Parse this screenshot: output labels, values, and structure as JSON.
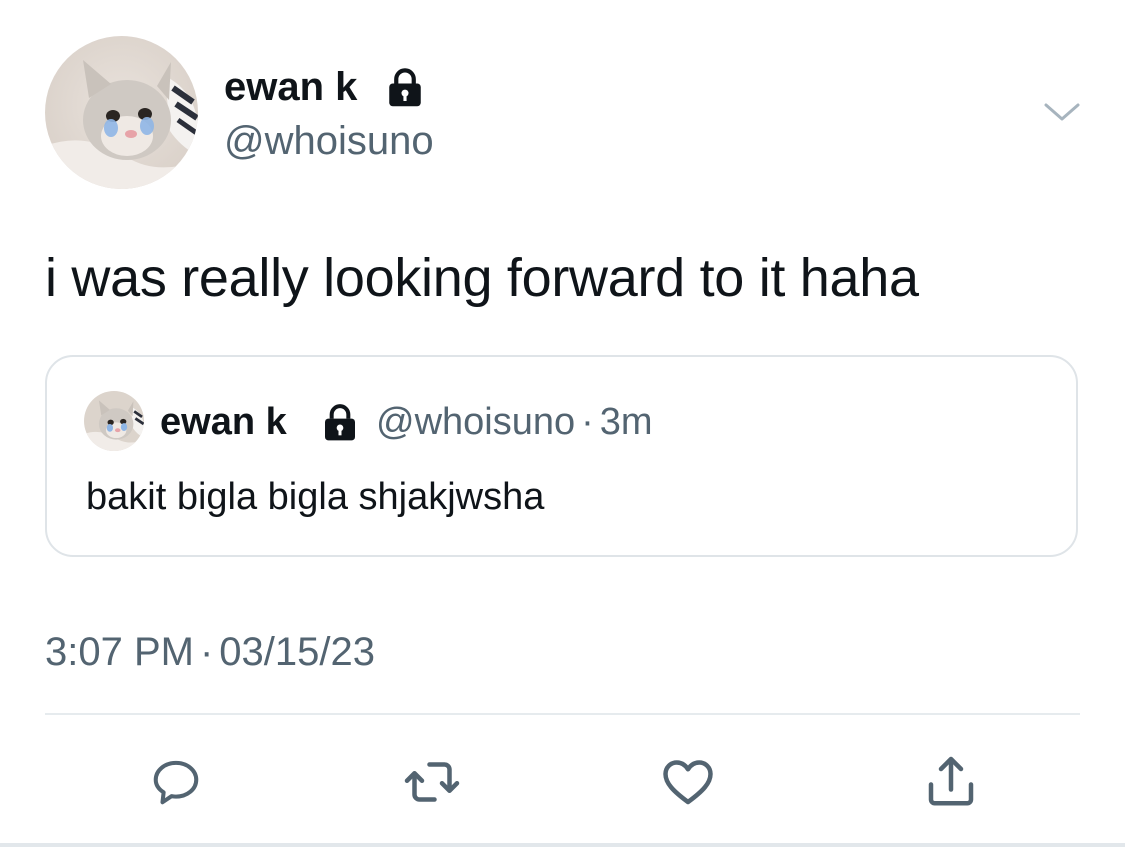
{
  "author": {
    "display_name": "ewan k",
    "handle": "@whoisuno",
    "avatar_icon": "cat-avatar",
    "protected_icon": "lock-icon"
  },
  "tweet": {
    "text": "i was really looking forward to it haha",
    "time": "3:07 PM",
    "separator": "·",
    "date": "03/15/23"
  },
  "quoted_tweet": {
    "display_name": "ewan k",
    "handle": "@whoisuno",
    "separator": "·",
    "age": "3m",
    "text": "bakit bigla bigla shjakjwsha"
  },
  "actions": {
    "reply_icon": "reply-icon",
    "retweet_icon": "retweet-icon",
    "like_icon": "heart-icon",
    "share_icon": "share-icon",
    "menu_icon": "chevron-down-icon"
  },
  "colors": {
    "text_primary": "#0f1419",
    "text_secondary": "#536471",
    "border": "#dfe4e8",
    "icon": "#536471"
  }
}
